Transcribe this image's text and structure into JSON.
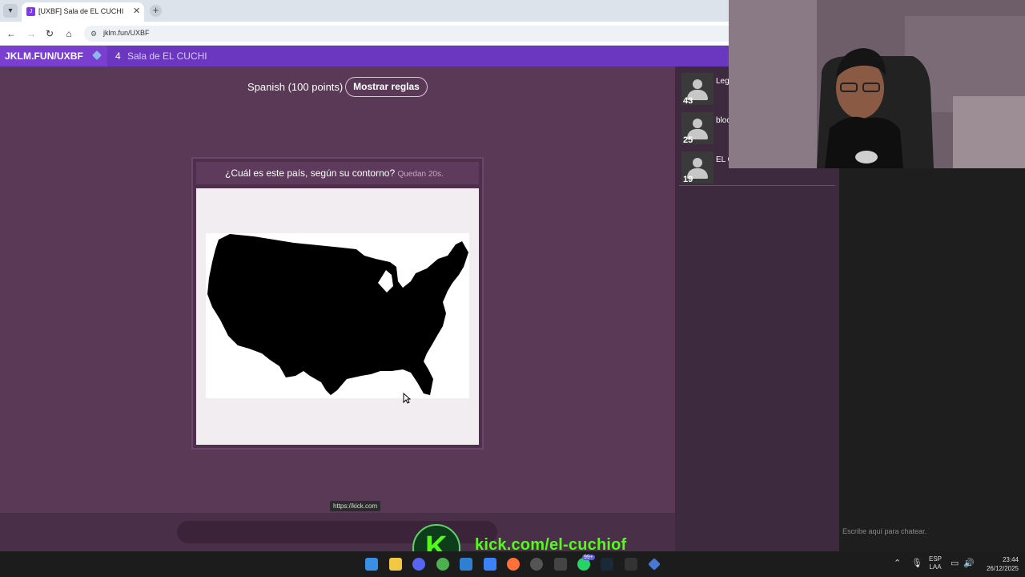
{
  "browser": {
    "tab_title": "[UXBF] Sala de EL CUCHI",
    "url": "jklm.fun/UXBF"
  },
  "header": {
    "brand": "JKLM.FUN/UXBF",
    "player_count": "4",
    "room_name": "Sala de EL CUCHI"
  },
  "game": {
    "language": "Spanish (100 points)",
    "rules_button": "Mostrar reglas",
    "prompt": "¿Cuál es este país, según su contorno?",
    "timer": "Quedan 20s.",
    "image_subject": "United States outline silhouette"
  },
  "link_tooltip": "https://kick.com",
  "players": [
    {
      "name": "Leg",
      "score": "43"
    },
    {
      "name": "bloc",
      "score": "25"
    },
    {
      "name": "EL C",
      "score": "19"
    }
  ],
  "chat": {
    "placeholder": "Escribe aquí para chatear."
  },
  "overlay": {
    "kick_url": "kick.com/el-cuchiof"
  },
  "taskbar": {
    "lang_1": "ESP",
    "lang_2": "LAA",
    "time": "23:44",
    "date": "26/12/2025",
    "whatsapp_badge": "99+"
  },
  "colors": {
    "accent": "#7a3fd1",
    "main_bg": "#5a3957",
    "kick_green": "#53fc18"
  }
}
